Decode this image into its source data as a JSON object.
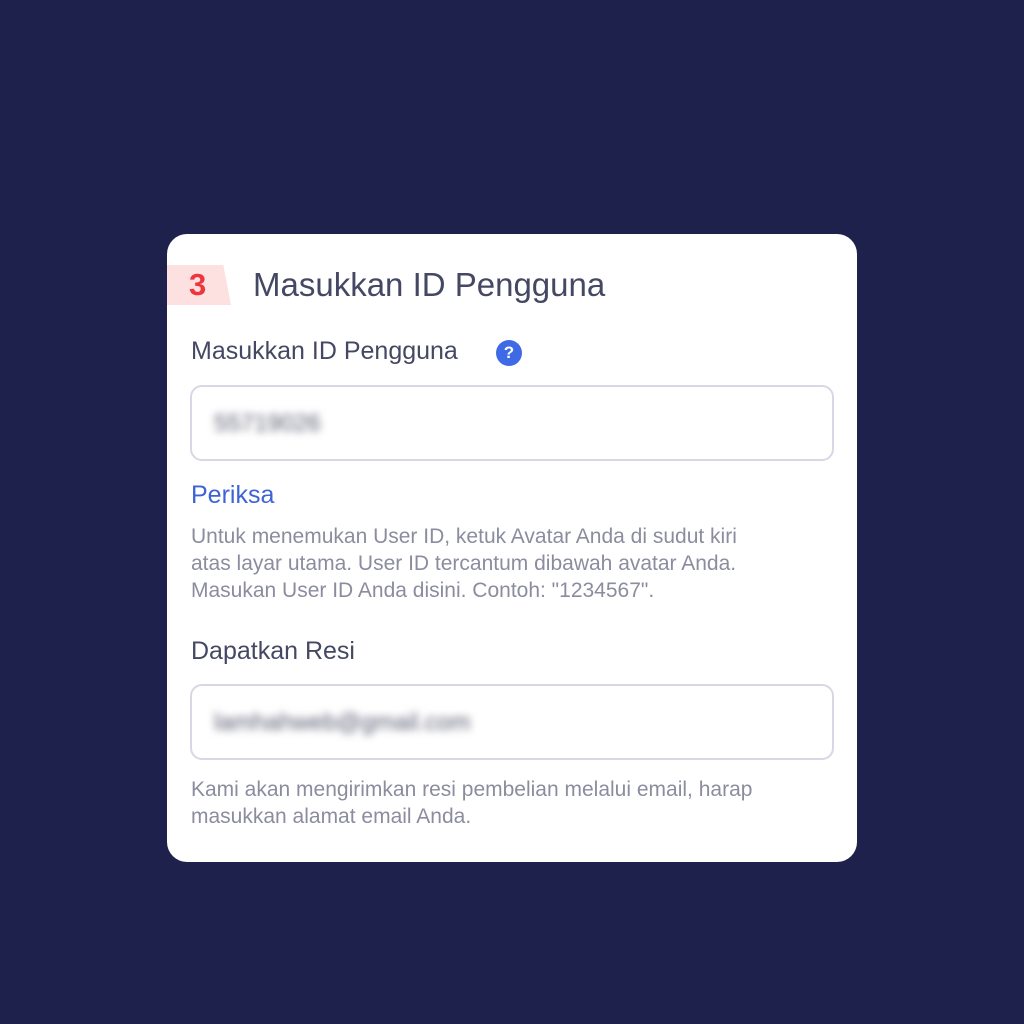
{
  "step": {
    "number": "3",
    "title": "Masukkan ID Pengguna"
  },
  "user_id": {
    "label": "Masukkan ID Pengguna",
    "help_icon": "question-mark-icon",
    "help_glyph": "?",
    "value": "55719026",
    "check_link": "Periksa",
    "hint_lines": [
      "Untuk menemukan User ID, ketuk Avatar Anda di sudut kiri",
      "atas layar utama. User ID tercantum dibawah avatar Anda.",
      "Masukan User ID Anda disini. Contoh: \"1234567\"."
    ]
  },
  "receipt": {
    "label": "Dapatkan Resi",
    "value": "lamhahweb@gmail.com",
    "hint_lines": [
      "Kami akan mengirimkan resi pembelian melalui email, harap",
      "masukkan alamat email Anda."
    ]
  },
  "colors": {
    "background": "#1f214d",
    "card": "#ffffff",
    "accent_red": "#f0343c",
    "badge_bg": "#fde0e0",
    "link_blue": "#3f63d6",
    "help_blue": "#3f6ae6"
  }
}
